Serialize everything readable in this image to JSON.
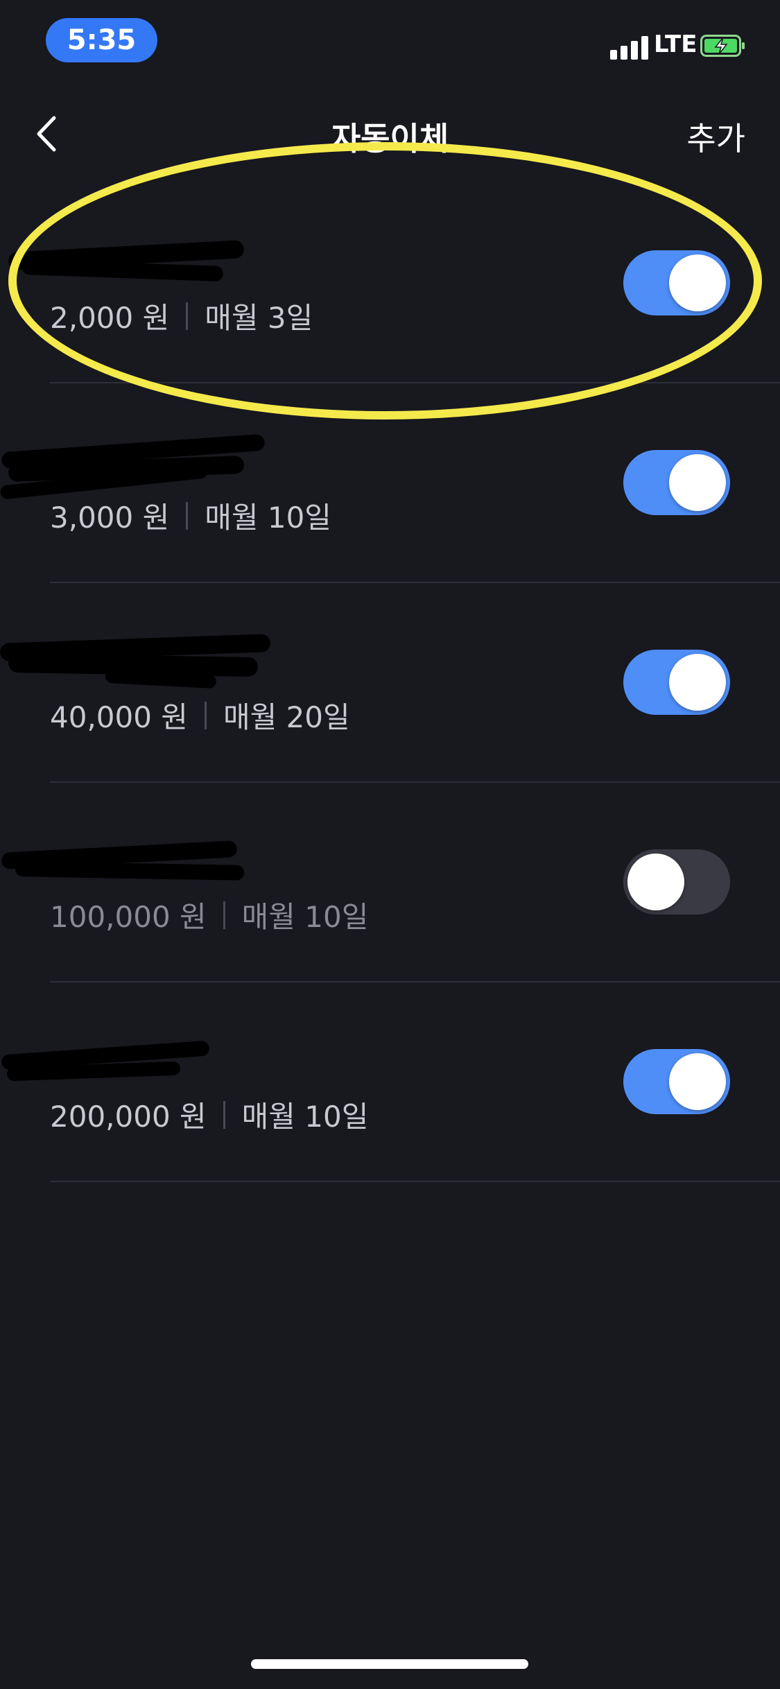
{
  "status_bar": {
    "time": "5:35",
    "network": "LTE"
  },
  "nav": {
    "title": "자동이체",
    "add_label": "추가"
  },
  "transfers": [
    {
      "amount": "2,000 원",
      "schedule": "매월 3일",
      "enabled": true
    },
    {
      "amount": "3,000 원",
      "schedule": "매월 10일",
      "enabled": true
    },
    {
      "amount": "40,000 원",
      "schedule": "매월 20일",
      "enabled": true
    },
    {
      "amount": "100,000 원",
      "schedule": "매월 10일",
      "enabled": false
    },
    {
      "amount": "200,000 원",
      "schedule": "매월 10일",
      "enabled": true
    }
  ],
  "colors": {
    "background": "#18181f",
    "toggle_on": "#4f8ef7",
    "toggle_off": "#3a3a44",
    "highlight": "#f5ea4c",
    "time_pill": "#3478f6"
  }
}
